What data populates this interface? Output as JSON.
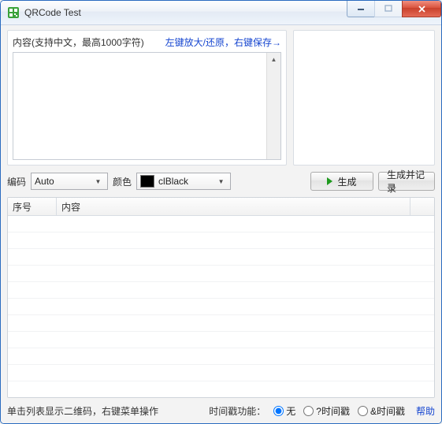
{
  "window": {
    "title": "QRCode Test"
  },
  "content": {
    "label": "内容(支持中文，最高1000字符)",
    "hint": "左键放大/还原，右键保存→",
    "value": ""
  },
  "encoding": {
    "label": "编码",
    "value": "Auto"
  },
  "color": {
    "label": "颜色",
    "value": "clBlack",
    "swatch": "#000000"
  },
  "buttons": {
    "generate": "生成",
    "generate_log": "生成并记录"
  },
  "table": {
    "col_seq": "序号",
    "col_content": "内容"
  },
  "footer": {
    "hint": "单击列表显示二维码，右键菜单操作",
    "ts_label": "时间戳功能：",
    "opt_none": "无",
    "opt_ts1": "?时间戳",
    "opt_ts2": "&时间戳",
    "help": "帮助"
  }
}
